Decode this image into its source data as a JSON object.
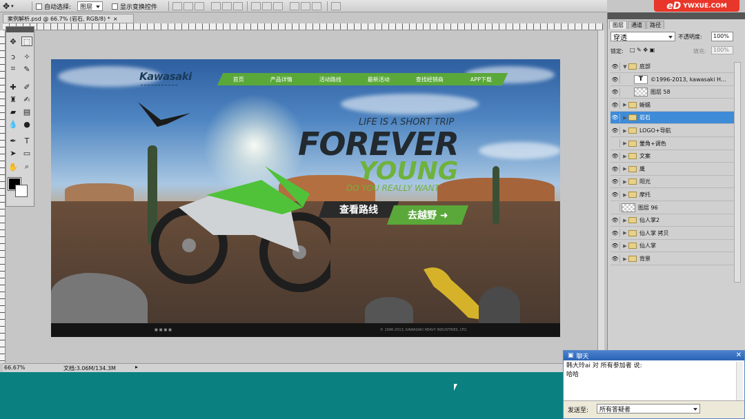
{
  "options_bar": {
    "auto_select_label": "自动选择:",
    "auto_select_value": "图层",
    "show_transform_label": "显示变换控件"
  },
  "brand": {
    "text": "YWXUE.COM"
  },
  "document": {
    "tab_title": "案例解析.psd @ 66.7% (岩石, RGB/8) *",
    "zoom": "66.67%",
    "doc_size": "文档:3.06M/134.3M"
  },
  "artwork": {
    "logo": "Kawasaki",
    "nav": [
      "首页",
      "产品详情",
      "活动路线",
      "最新活动",
      "查找经销商",
      "APP下载"
    ],
    "tagline_small": "LIFE IS A SHORT TRIP",
    "tagline_big": "FOREVER",
    "tagline_green": "YOUNG",
    "tagline_question": "DO YOU REALLY WANT",
    "button_route": "查看路线",
    "button_offroad": "去越野",
    "footer_copyright": "© 1996-2013, KAWASAKI HEAVY INDUSTRIES, LTD."
  },
  "panel": {
    "tabs": [
      "图层",
      "通道",
      "路径"
    ],
    "blend_mode": "穿透",
    "opacity_label": "不透明度:",
    "opacity_value": "100%",
    "lock_label": "锁定:",
    "fill_label": "填充:",
    "fill_value": "100%",
    "layers": [
      {
        "name": "底部",
        "type": "folder",
        "visible": true,
        "expanded": true
      },
      {
        "name": "©1996-2013, kawasaki H...",
        "type": "text",
        "visible": true
      },
      {
        "name": "图层 58",
        "type": "layer",
        "visible": true
      },
      {
        "name": "蜥蜴",
        "type": "folder",
        "visible": true
      },
      {
        "name": "岩石",
        "type": "folder",
        "visible": true,
        "selected": true
      },
      {
        "name": "LOGO+导航",
        "type": "folder",
        "visible": true
      },
      {
        "name": "暈角+调色",
        "type": "folder",
        "visible": false
      },
      {
        "name": "文案",
        "type": "folder",
        "visible": true
      },
      {
        "name": "鹰",
        "type": "folder",
        "visible": true
      },
      {
        "name": "阳光",
        "type": "folder",
        "visible": true
      },
      {
        "name": "摩托",
        "type": "folder",
        "visible": true
      },
      {
        "name": "图层 96",
        "type": "layer",
        "visible": false
      },
      {
        "name": "仙人掌2",
        "type": "folder",
        "visible": true
      },
      {
        "name": "仙人掌 拷贝",
        "type": "folder",
        "visible": true
      },
      {
        "name": "仙人掌",
        "type": "folder",
        "visible": true
      },
      {
        "name": "背景",
        "type": "folder",
        "visible": true
      }
    ]
  },
  "chat": {
    "title": "聊天",
    "message_header": "韩大玲ai 对 所有参加者 说:",
    "message_text": "哈哈",
    "send_to_label": "发送至:",
    "send_to_value": "所有答疑者"
  }
}
